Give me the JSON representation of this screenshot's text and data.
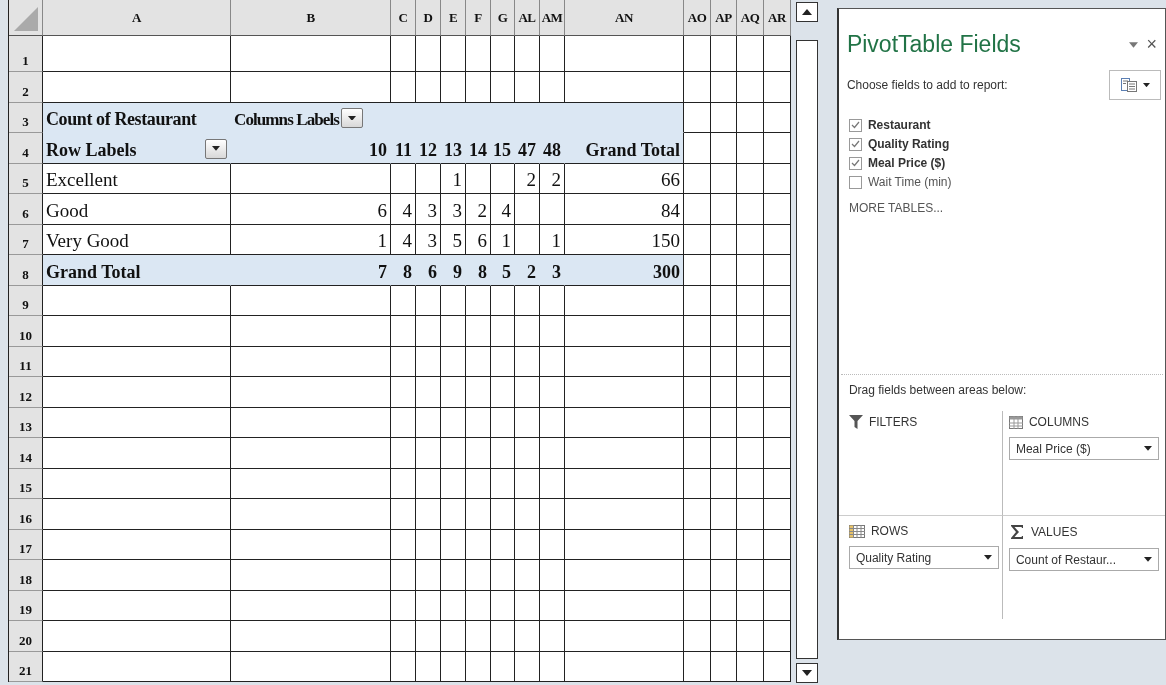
{
  "sheet": {
    "column_headers": [
      "A",
      "B",
      "C",
      "D",
      "E",
      "F",
      "G",
      "AL",
      "AM",
      "AN",
      "AO",
      "AP",
      "AQ",
      "AR"
    ],
    "row_numbers": [
      "1",
      "2",
      "3",
      "4",
      "5",
      "6",
      "7",
      "8",
      "9",
      "10",
      "11",
      "12",
      "13",
      "14",
      "15",
      "16",
      "17",
      "18",
      "19",
      "20",
      "21"
    ],
    "pivot": {
      "value_label": "Count of Restaurant",
      "column_labels_label": "Columns Labels",
      "row_labels_label": "Row Labels",
      "column_values": [
        "10",
        "11",
        "12",
        "13",
        "14",
        "15",
        "47",
        "48"
      ],
      "grand_total_label": "Grand Total",
      "rows": [
        {
          "label": "Excellent",
          "values": [
            {
              "empty": true
            },
            {
              "empty": true
            },
            {
              "empty": true
            },
            {
              "value": "1"
            },
            {
              "empty": true
            },
            {
              "empty": true
            },
            {
              "value": "2"
            },
            {
              "value": "2"
            }
          ],
          "total": "66"
        },
        {
          "label": "Good",
          "values": [
            {
              "value": "6"
            },
            {
              "value": "4"
            },
            {
              "value": "3"
            },
            {
              "value": "3"
            },
            {
              "value": "2"
            },
            {
              "value": "4"
            },
            {
              "empty": true
            },
            {
              "empty": true
            }
          ],
          "total": "84"
        },
        {
          "label": "Very Good",
          "values": [
            {
              "value": "1"
            },
            {
              "value": "4"
            },
            {
              "value": "3"
            },
            {
              "value": "5"
            },
            {
              "value": "6"
            },
            {
              "value": "1"
            },
            {
              "empty": true
            },
            {
              "value": "1"
            }
          ],
          "total": "150"
        }
      ],
      "grand_total_row": {
        "label": "Grand Total",
        "values": [
          {
            "value": "7"
          },
          {
            "value": "8"
          },
          {
            "value": "6"
          },
          {
            "value": "9"
          },
          {
            "value": "8"
          },
          {
            "value": "5"
          },
          {
            "value": "2"
          },
          {
            "value": "3"
          }
        ],
        "total": "300"
      }
    }
  },
  "field_list": {
    "title": "PivotTable Fields",
    "close_glyph": "×",
    "prompt": "Choose fields to add to report:",
    "fields": [
      {
        "label": "Restaurant",
        "checked": true
      },
      {
        "label": "Quality Rating",
        "checked": true
      },
      {
        "label": "Meal Price ($)",
        "checked": true
      },
      {
        "label": "Wait Time (min)",
        "checked": false
      }
    ],
    "more_tables": "MORE TABLES...",
    "drag_hint": "Drag fields between areas below:",
    "areas": [
      {
        "kind": "filters",
        "label": "FILTERS"
      },
      {
        "kind": "columns",
        "label": "COLUMNS",
        "fields": [
          "Meal Price ($)"
        ]
      },
      {
        "kind": "rows",
        "label": "ROWS",
        "fields": [
          "Quality Rating"
        ]
      },
      {
        "kind": "values",
        "label": "VALUES",
        "fields": [
          "Count of Restaur..."
        ]
      }
    ]
  }
}
